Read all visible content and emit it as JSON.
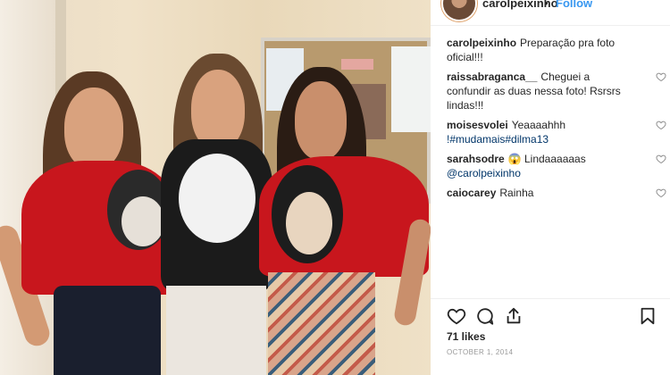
{
  "post": {
    "username": "carolpeixinho",
    "dot": "•",
    "follow_label": "Follow",
    "likes": "71 likes",
    "date": "OCTOBER 1, 2014"
  },
  "comments": [
    {
      "user": "carolpeixinho",
      "text": "Preparação pra foto oficial!!!",
      "tag": "",
      "text_after": ""
    },
    {
      "user": "raissabraganca__",
      "text": "Cheguei a confundir as duas nessa foto! Rsrsrs lindas!!!",
      "tag": "",
      "text_after": ""
    },
    {
      "user": "moisesvolei",
      "text": "Yeaaaahhh",
      "tag": "!#mudamais#dilma13",
      "text_after": ""
    },
    {
      "user": "sarahsodre",
      "text": "😱 Lindaaaaaas",
      "tag": "@carolpeixinho",
      "text_after": ""
    },
    {
      "user": "caiocarey",
      "text": "Rainha",
      "tag": "",
      "text_after": ""
    }
  ],
  "icons": {
    "like": "heart-icon",
    "comment": "comment-icon",
    "share": "share-icon",
    "save": "bookmark-icon"
  },
  "colors": {
    "link": "#3897f0",
    "hashtag": "#003569",
    "shirt_red": "#c8161d"
  }
}
